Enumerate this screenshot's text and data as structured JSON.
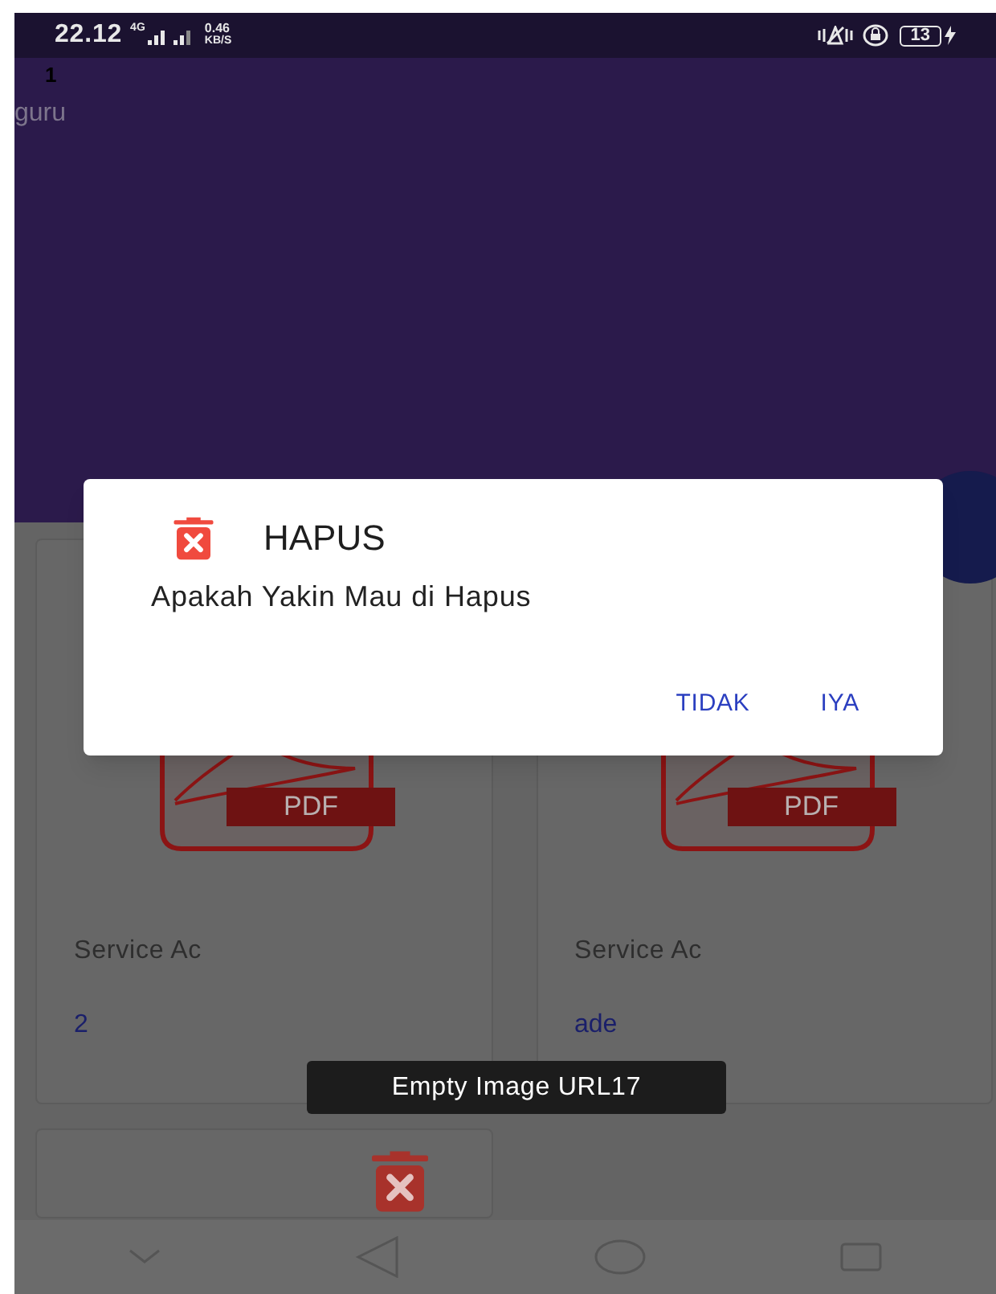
{
  "status_bar": {
    "time": "22.12",
    "network": "4G",
    "speed": "0.46",
    "speed_unit": "KB/S",
    "battery": "13"
  },
  "header": {
    "count": "1",
    "role": "guru"
  },
  "cards": [
    {
      "kind": "pdf",
      "badge": "PDF",
      "title": "Service Ac",
      "subtitle": "2"
    },
    {
      "kind": "pdf",
      "badge": "PDF",
      "title": "Service Ac",
      "subtitle": "ade"
    },
    {
      "kind": "trash"
    }
  ],
  "dialog": {
    "title": "HAPUS",
    "message": "Apakah Yakin Mau di Hapus",
    "buttons": [
      "TIDAK",
      "IYA"
    ]
  },
  "toast": "Empty Image URL17"
}
